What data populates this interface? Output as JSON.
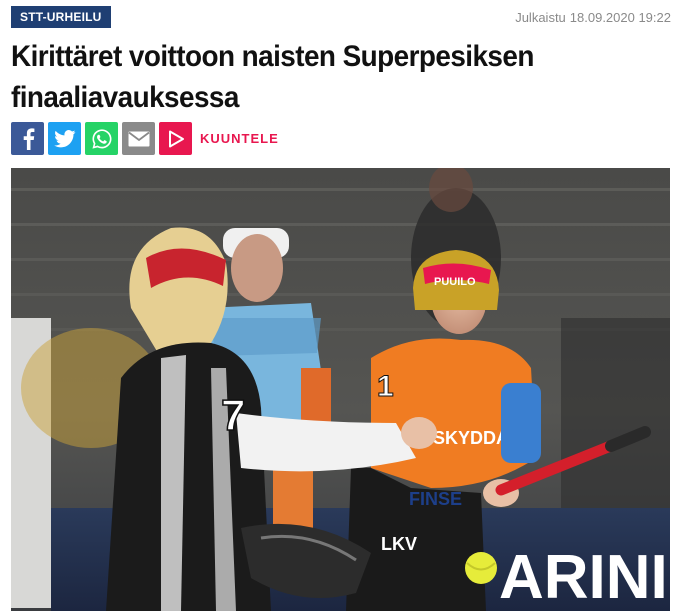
{
  "article": {
    "category": "STT-URHEILU",
    "published_label": "Julkaistu",
    "published_date": "18.09.2020 19:22",
    "headline": "Kirittäret voittoon naisten Superpesiksen finaaliavauksessa"
  },
  "share": {
    "icons": [
      "facebook-icon",
      "twitter-icon",
      "whatsapp-icon",
      "email-icon",
      "play-icon"
    ],
    "listen_label": "KUUNTELE"
  },
  "photo": {
    "jersey_number_left": "7",
    "jersey_number_right": "1",
    "helmet_text": "PUUILO",
    "sponsor_skydda": "SKYDDA",
    "sponsor_finsec": "FINSE",
    "sponsor_lkv": "LKV",
    "board_text": "ARINI"
  },
  "colors": {
    "category_bg": "#1f3f73",
    "facebook": "#3b5998",
    "twitter": "#1da1f2",
    "whatsapp": "#25d366",
    "email": "#8a8a8a",
    "listen": "#e8174f"
  }
}
